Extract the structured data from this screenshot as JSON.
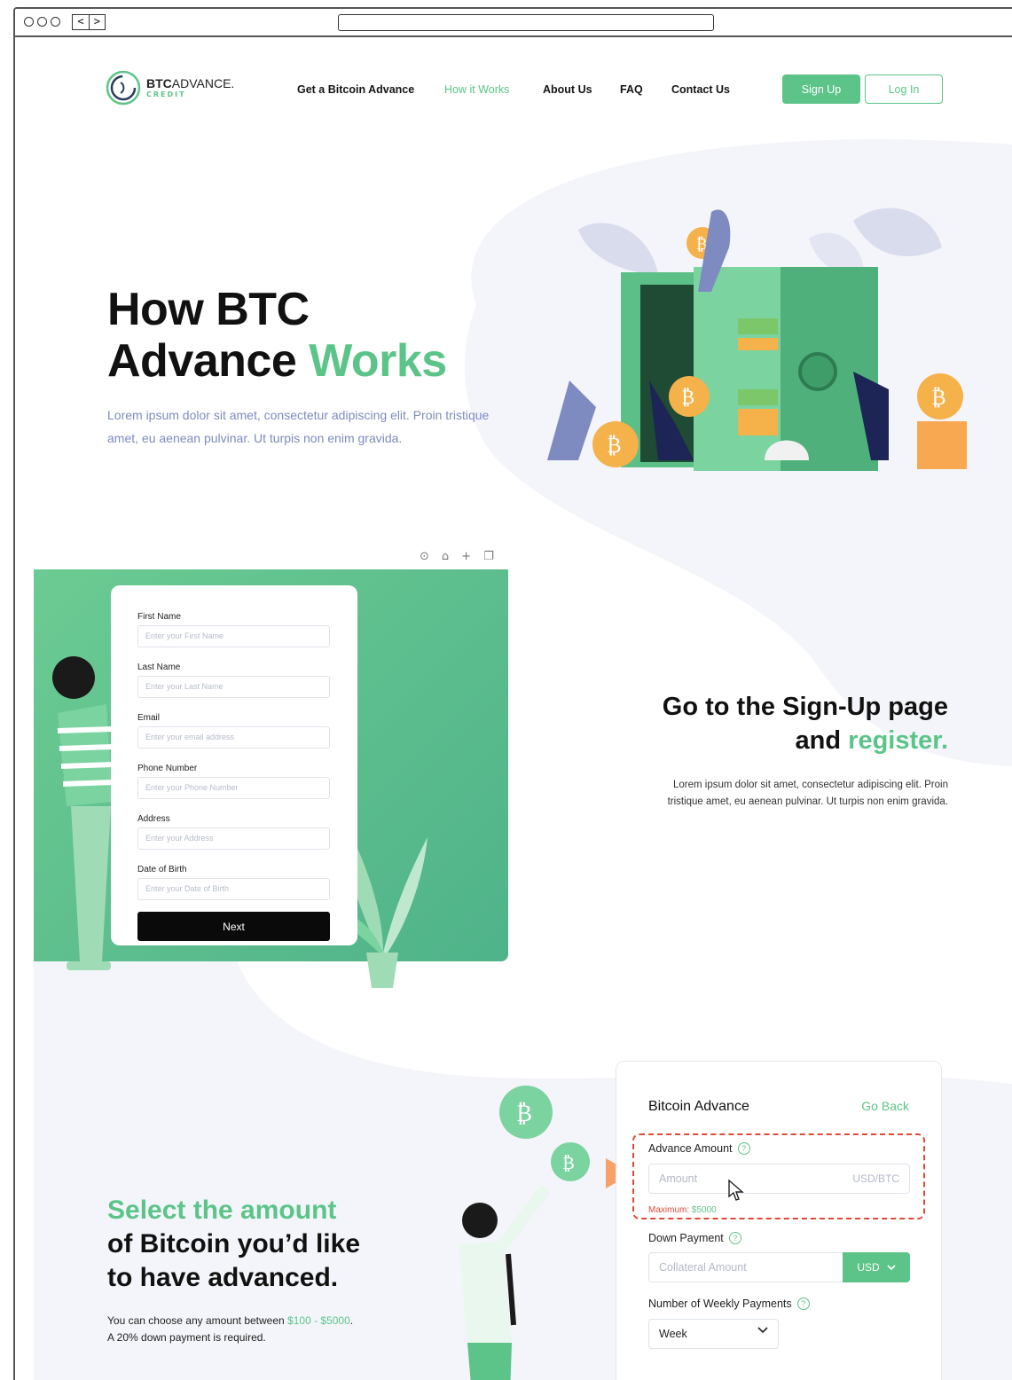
{
  "browser": {
    "back_glyph": "<",
    "forward_glyph": ">"
  },
  "header": {
    "logo_brand_bold": "BTC",
    "logo_brand_rest": "ADVANCE.",
    "logo_sub": "CREDIT",
    "nav": [
      {
        "label": "Get a Bitcoin Advance",
        "active": false
      },
      {
        "label": "How it Works",
        "active": true
      },
      {
        "label": "About Us",
        "active": false
      },
      {
        "label": "FAQ",
        "active": false
      },
      {
        "label": "Contact Us",
        "active": false
      }
    ],
    "signup_label": "Sign Up",
    "login_label": "Log In"
  },
  "hero": {
    "title_line1": "How BTC",
    "title_line2_dark": "Advance ",
    "title_line2_green": "Works",
    "description": "Lorem ipsum dolor sit amet, consectetur adipiscing elit. Proin tristique amet, eu aenean pulvinar. Ut turpis non enim gravida."
  },
  "signup_form": {
    "fields": [
      {
        "label": "First Name",
        "placeholder": "Enter your First Name"
      },
      {
        "label": "Last Name",
        "placeholder": "Enter your Last Name"
      },
      {
        "label": "Email",
        "placeholder": "Enter your email address"
      },
      {
        "label": "Phone Number",
        "placeholder": "Enter your Phone Number"
      },
      {
        "label": "Address",
        "placeholder": "Enter your Address"
      },
      {
        "label": "Date of Birth",
        "placeholder": "Enter your Date of Birth"
      }
    ],
    "next_label": "Next"
  },
  "section_signup": {
    "title_line1": "Go to the Sign-Up page",
    "title_line2_dark": "and ",
    "title_line2_green": "register.",
    "description": "Lorem ipsum dolor sit amet, consectetur adipiscing elit. Proin tristique amet, eu aenean pulvinar. Ut turpis non enim gravida."
  },
  "section_amount": {
    "title_green": "Select the amount",
    "title_line2": "of Bitcoin you’d like",
    "title_line3": "to have advanced.",
    "desc_prefix": "You can choose any amount between ",
    "desc_range": "$100 - $5000",
    "desc_suffix": ".",
    "desc_line2": "A 20% down payment is required."
  },
  "advance_card": {
    "title": "Bitcoin Advance",
    "go_back": "Go Back",
    "advance_amount_label": "Advance Amount",
    "amount_placeholder": "Amount",
    "amount_unit": "USD/BTC",
    "maximum_label": "Maximum: ",
    "maximum_value": "$5000",
    "down_payment_label": "Down Payment",
    "collateral_placeholder": "Collateral Amount",
    "currency": "USD",
    "weekly_payments_label": "Number of Weekly Payments",
    "weekly_value": "Week"
  },
  "colors": {
    "accent_green": "#5cc489",
    "highlight_red": "#e0483a",
    "hero_text_blue": "#7d8bc0"
  }
}
